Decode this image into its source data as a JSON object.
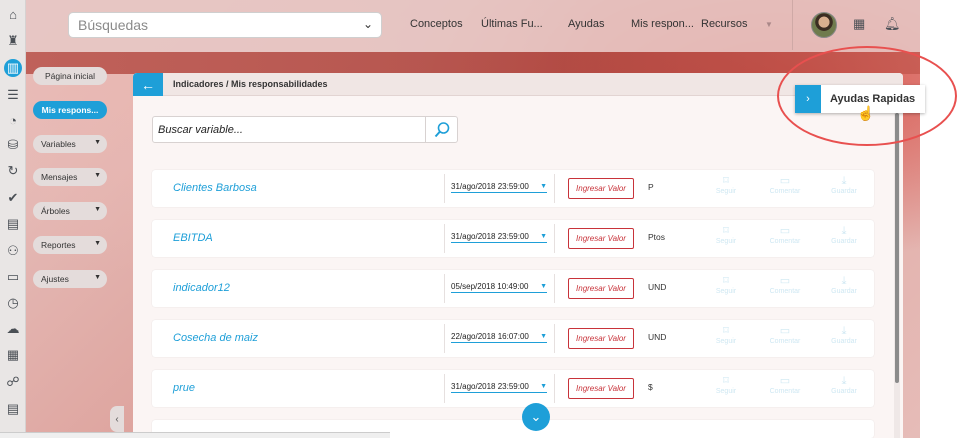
{
  "topbar": {
    "search_placeholder": "Búsquedas",
    "nav": [
      "Conceptos",
      "Últimas Fu...",
      "Ayudas",
      "Mis respon...",
      "Recursos"
    ]
  },
  "sidenav": {
    "items": [
      {
        "label": "Página inicial",
        "active": false,
        "dropdown": false
      },
      {
        "label": "Mis respons...",
        "active": true,
        "dropdown": false
      },
      {
        "label": "Variables",
        "active": false,
        "dropdown": true
      },
      {
        "label": "Mensajes",
        "active": false,
        "dropdown": true
      },
      {
        "label": "Árboles",
        "active": false,
        "dropdown": true
      },
      {
        "label": "Reportes",
        "active": false,
        "dropdown": true
      },
      {
        "label": "Ajustes",
        "active": false,
        "dropdown": true
      }
    ]
  },
  "main": {
    "breadcrumb": "Indicadores / Mis responsabilidades",
    "search_placeholder": "Buscar variable...",
    "ingresar_label": "Ingresar Valor",
    "actions": [
      "Seguir",
      "Comentar",
      "Guardar"
    ],
    "rows": [
      {
        "name": "Clientes Barbosa",
        "date": "31/ago/2018 23:59:00",
        "unit": "P"
      },
      {
        "name": "EBITDA",
        "date": "31/ago/2018 23:59:00",
        "unit": "Ptos"
      },
      {
        "name": "indicador12",
        "date": "05/sep/2018 10:49:00",
        "unit": "UND"
      },
      {
        "name": "Cosecha de maiz",
        "date": "22/ago/2018 16:07:00",
        "unit": "UND"
      },
      {
        "name": "prue",
        "date": "31/ago/2018 23:59:00",
        "unit": "$"
      }
    ]
  },
  "ayudas_rapidas": {
    "label": "Ayudas Rapidas"
  },
  "colors": {
    "accent": "#1e9fd8",
    "danger": "#c8333a",
    "highlight_circle": "#e8504f"
  }
}
